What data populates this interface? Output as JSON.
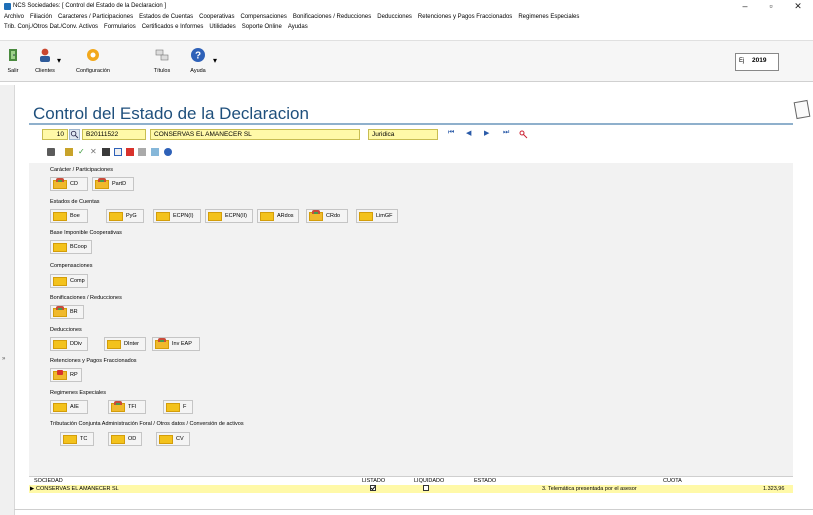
{
  "window": {
    "title": "NCS Sociedades: [ Control del Estado de la Declaracion ]",
    "min_glyph": "–",
    "max_glyph": "▫",
    "close_glyph": "✕"
  },
  "menu_row1": [
    "Archivo",
    "Filiación",
    "Caracteres / Participaciones",
    "Estados de Cuentas",
    "Cooperativas",
    "Compensaciones",
    "Bonificaciones / Reducciones",
    "Deducciones",
    "Retenciones y Pagos Fraccionados",
    "Regimenes Especiales"
  ],
  "menu_row2": [
    "Trib. Conj./Otros Dat./Conv. Activos",
    "Formularios",
    "Certificados e Informes",
    "Utilidades",
    "Soporte Online",
    "Ayudas"
  ],
  "toolbar": {
    "buttons": [
      {
        "label": "Salir",
        "icon": "exit-door-icon"
      },
      {
        "label": "Clientes",
        "icon": "user-icon"
      },
      {
        "label": "Configuración",
        "icon": "gear-icon"
      },
      {
        "label": "Títulos",
        "icon": "titles-icon"
      },
      {
        "label": "Ayuda",
        "icon": "help-icon"
      }
    ],
    "ejercicio_label": "Ej",
    "ejercicio_value": "2019"
  },
  "page": {
    "title": "Control del Estado de la Declaracion"
  },
  "record": {
    "number": "10",
    "nif": "B20111522",
    "name": "CONSERVAS EL AMANECER SL",
    "type": "Juridica",
    "nav": [
      "⏮",
      "◀",
      "▶",
      "⏭"
    ]
  },
  "sections": {
    "caracter": {
      "title": "Carácter / Participaciones",
      "buttons": [
        "CD",
        "PartD"
      ]
    },
    "estados": {
      "title": "Estados de Cuentas",
      "buttons": [
        "Boe",
        "PyG",
        "ECPN(I)",
        "ECPN(II)",
        "ARdos",
        "CRdo",
        "LimGF"
      ]
    },
    "base": {
      "title": "Base Imponible Cooperativas",
      "buttons": [
        "BCoop"
      ]
    },
    "compensaciones": {
      "title": "Compensaciones",
      "buttons": [
        "Comp"
      ]
    },
    "bonificaciones": {
      "title": "Bonificaciones / Reducciones",
      "buttons": [
        "BR"
      ]
    },
    "deducciones": {
      "title": "Deducciones",
      "buttons": [
        "DDiv",
        "DInter",
        "Inv EAP"
      ]
    },
    "retenciones": {
      "title": "Retenciones y Pagos Fraccionados",
      "buttons": [
        "RP"
      ]
    },
    "regimenes": {
      "title": "Regimenes Especiales",
      "buttons": [
        "AIE",
        "TFI",
        "F"
      ]
    },
    "tributacion": {
      "title": "Tributación Conjunta Administración Foral / Otros datos / Conversión de activos",
      "buttons": [
        "TC",
        "OD",
        "CV"
      ]
    }
  },
  "grid": {
    "headers": {
      "sociedad": "SOCIEDAD",
      "listado": "LISTADO",
      "liquidado": "LIQUIDADO",
      "estado": "ESTADO",
      "cuota": "CUOTA"
    },
    "row": {
      "sociedad": "CONSERVAS EL AMANECER SL",
      "listado": true,
      "liquidado": false,
      "estado": "3. Telemática presentada por el asesor",
      "cuota": "1.323,96"
    }
  },
  "left_strip_glyph": "»"
}
